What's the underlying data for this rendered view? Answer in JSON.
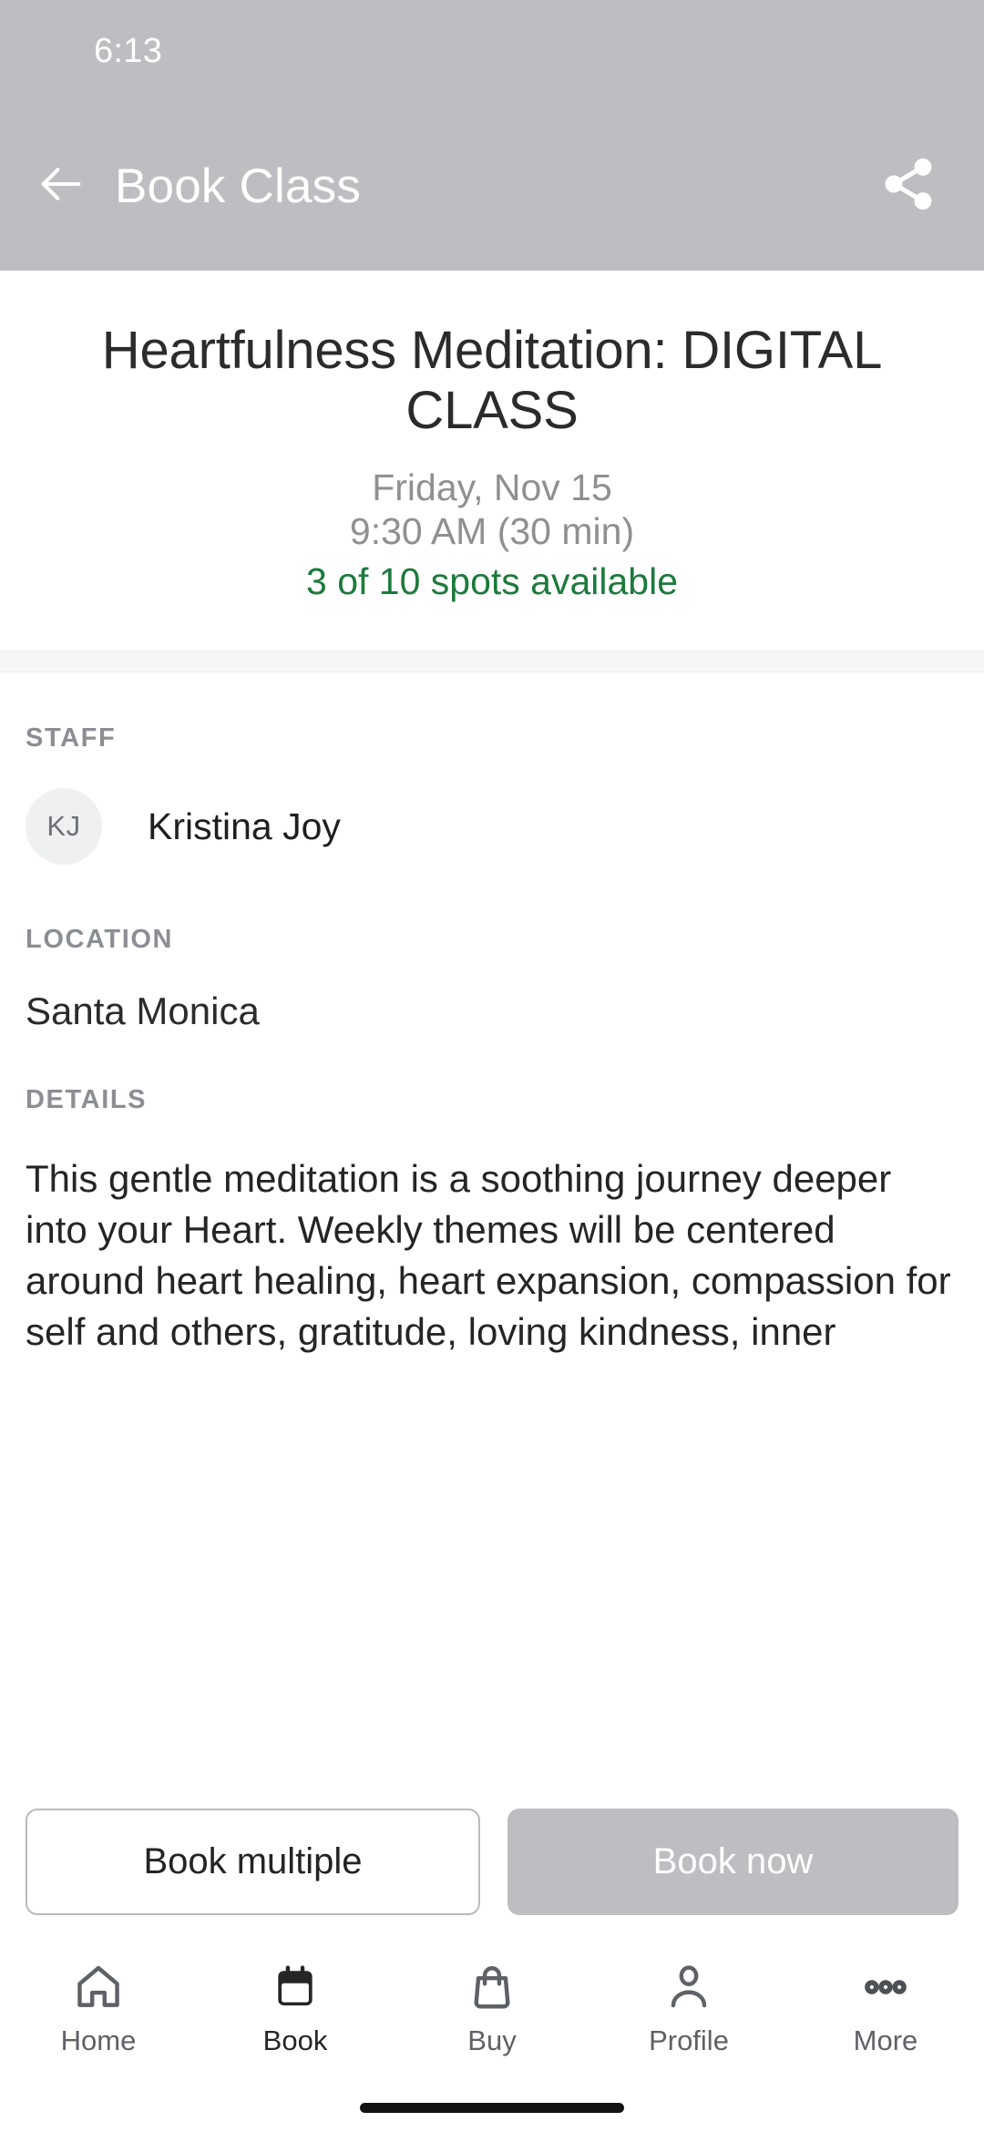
{
  "status_bar": {
    "clock": "6:13"
  },
  "app_bar": {
    "title": "Book Class",
    "back_icon": "arrow-left-icon",
    "share_icon": "share-icon"
  },
  "hero": {
    "class_title": "Heartfulness Meditation: DIGITAL CLASS",
    "date": "Friday, Nov 15",
    "time": "9:30 AM (30 min)",
    "spots": "3 of 10 spots available",
    "spots_color": "#1d7a3c"
  },
  "staff": {
    "label": "STAFF",
    "initials": "KJ",
    "name": "Kristina Joy"
  },
  "location": {
    "label": "LOCATION",
    "value": "Santa Monica"
  },
  "details": {
    "label": "DETAILS",
    "text": "This gentle meditation is a soothing journey deeper into your Heart. Weekly themes will be centered around heart healing, heart expansion, compassion for self and others, gratitude, loving kindness, inner peace, and"
  },
  "actions": {
    "book_multiple_label": "Book multiple",
    "book_now_label": "Book now",
    "book_now_bg": "#bdbec1"
  },
  "bottom_nav": {
    "items": [
      {
        "label": "Home",
        "icon": "home-icon",
        "active": false
      },
      {
        "label": "Book",
        "icon": "calendar-icon",
        "active": true
      },
      {
        "label": "Buy",
        "icon": "bag-icon",
        "active": false
      },
      {
        "label": "Profile",
        "icon": "person-icon",
        "active": false
      },
      {
        "label": "More",
        "icon": "ellipsis-icon",
        "active": false
      }
    ]
  },
  "theme": {
    "header_bg": "#bdbec1",
    "accent_green": "#1d7a3c",
    "muted_text": "#909090",
    "label_text": "#8b8e93"
  }
}
